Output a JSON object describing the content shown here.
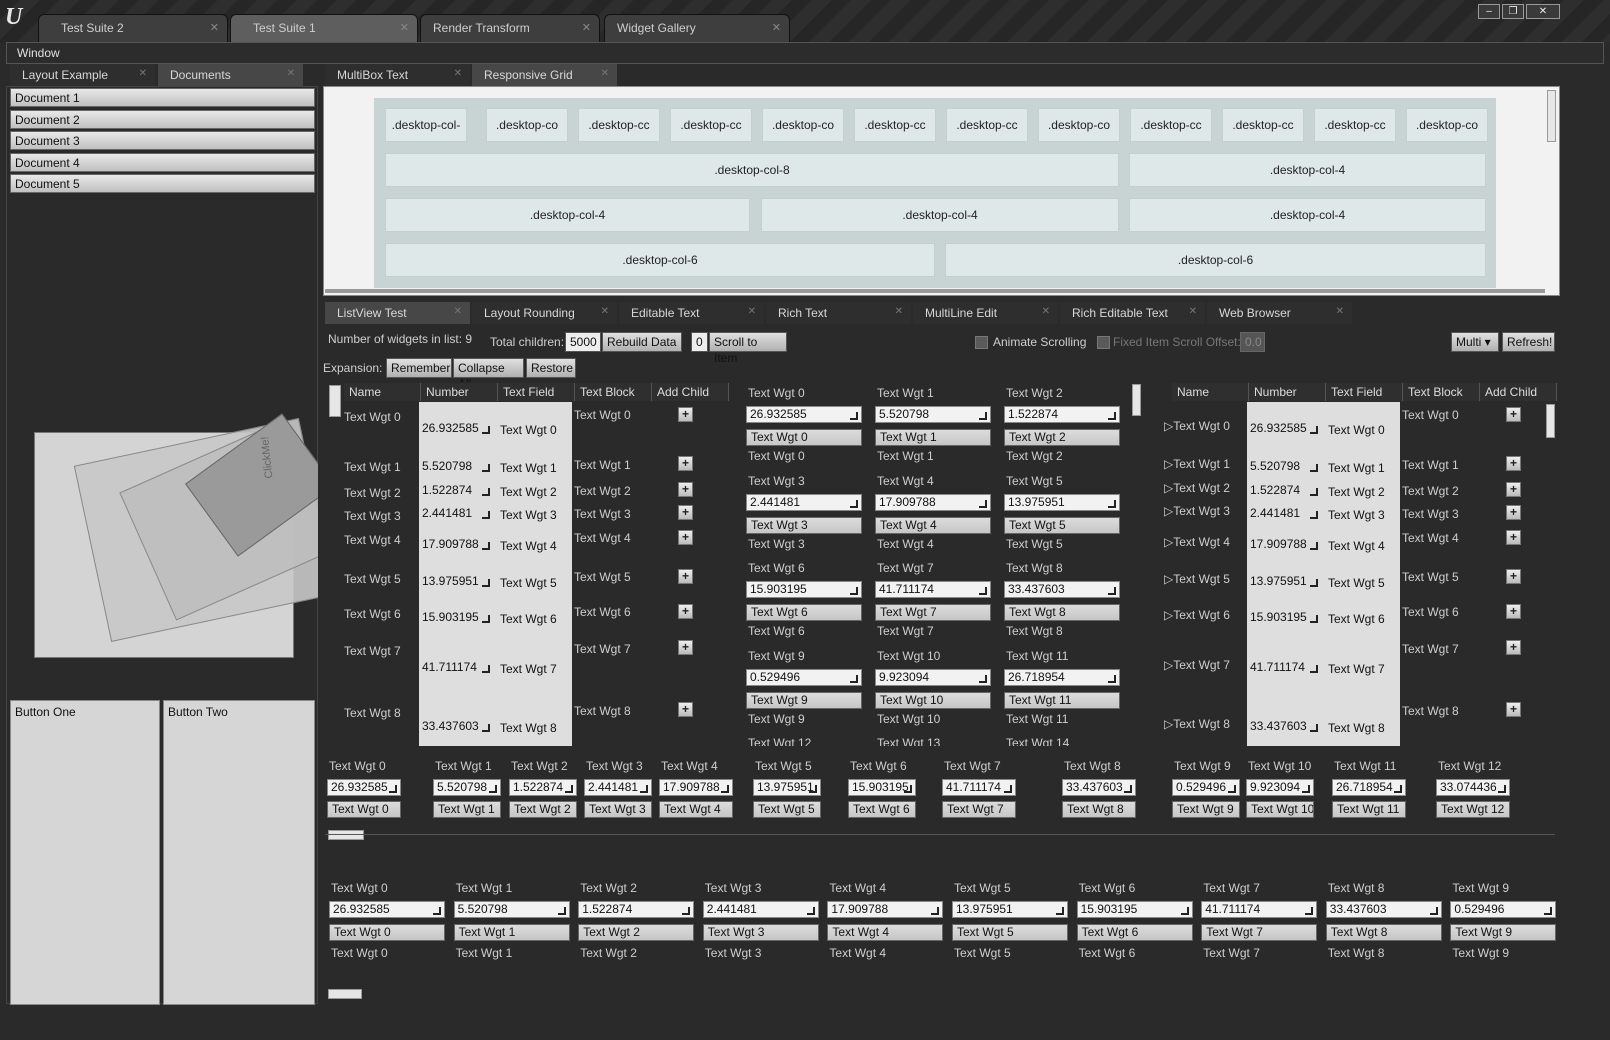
{
  "window": {
    "tabs": [
      "Test Suite 2",
      "Test Suite 1",
      "Render Transform",
      "Widget Gallery"
    ],
    "menu": "Window",
    "controls": [
      "–",
      "❐",
      "✕"
    ]
  },
  "left": {
    "tabs": [
      "Layout Example",
      "Documents"
    ],
    "docs": [
      "Document 1",
      "Document 2",
      "Document 3",
      "Document 4",
      "Document 5"
    ],
    "clickme": "ClickMe!",
    "button_one": "Button One",
    "button_two": "Button Two"
  },
  "top_tabs": [
    "MultiBox Text",
    "Responsive Grid"
  ],
  "grid": {
    "row1": [
      ".desktop-col-",
      ".desktop-co",
      ".desktop-cc",
      ".desktop-cc",
      ".desktop-co",
      ".desktop-cc",
      ".desktop-cc",
      ".desktop-co",
      ".desktop-cc",
      ".desktop-cc",
      ".desktop-cc",
      ".desktop-co"
    ],
    "row2": [
      ".desktop-col-8",
      ".desktop-col-4"
    ],
    "row3": [
      ".desktop-col-4",
      ".desktop-col-4",
      ".desktop-col-4"
    ],
    "row4": [
      ".desktop-col-6",
      ".desktop-col-6"
    ]
  },
  "bottom_tabs": [
    "ListView Test",
    "Layout Rounding",
    "Editable Text",
    "Rich Text",
    "MultiLine Edit",
    "Rich Editable Text",
    "Web Browser"
  ],
  "toolbar": {
    "count_label": "Number of widgets in list: 9",
    "total_label": "Total children:",
    "total_value": "5000",
    "rebuild": "Rebuild Data",
    "scroll_index": "0",
    "scroll_to": "Scroll to Item",
    "animate": "Animate Scrolling",
    "fixed_offset": "Fixed Item Scroll Offset:",
    "offset_value": "0.0",
    "multi": "Multi",
    "refresh": "Refresh!",
    "expansion": "Expansion:",
    "remember": "Remember",
    "collapse": "Collapse All",
    "restore": "Restore"
  },
  "columns": [
    "Name",
    "Number",
    "Text Field",
    "Text Block",
    "Add Child"
  ],
  "items": [
    {
      "name": "Text Wgt 0",
      "num": "26.932585"
    },
    {
      "name": "Text Wgt 1",
      "num": "5.520798"
    },
    {
      "name": "Text Wgt 2",
      "num": "1.522874"
    },
    {
      "name": "Text Wgt 3",
      "num": "2.441481"
    },
    {
      "name": "Text Wgt 4",
      "num": "17.909788"
    },
    {
      "name": "Text Wgt 5",
      "num": "13.975951"
    },
    {
      "name": "Text Wgt 6",
      "num": "15.903195"
    },
    {
      "name": "Text Wgt 7",
      "num": "41.711174"
    },
    {
      "name": "Text Wgt 8",
      "num": "33.437603"
    },
    {
      "name": "Text Wgt 9",
      "num": "0.529496"
    },
    {
      "name": "Text Wgt 10",
      "num": "9.923094"
    },
    {
      "name": "Text Wgt 11",
      "num": "26.718954"
    },
    {
      "name": "Text Wgt 12",
      "num": "33.074436"
    }
  ],
  "tile_extra": [
    "Text Wgt 12",
    "Text Wgt 13",
    "Text Wgt 14"
  ],
  "plus": "+",
  "expander": "▷"
}
